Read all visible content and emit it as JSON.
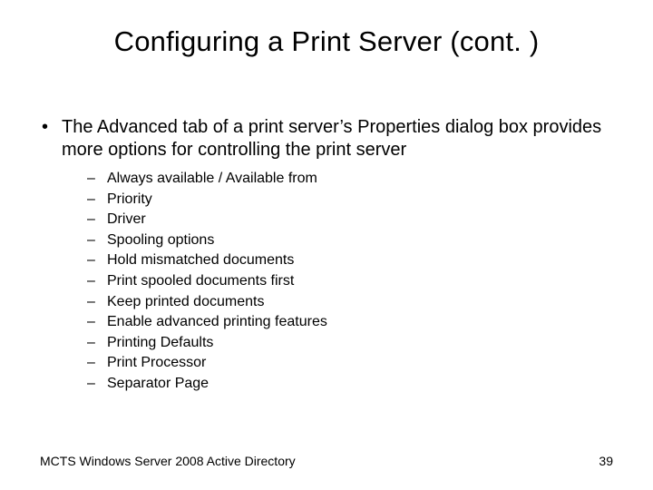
{
  "title": "Configuring a Print Server (cont. )",
  "bullet": {
    "text": "The Advanced tab of a print server’s Properties dialog box provides more options for controlling the print server",
    "sub": [
      "Always available / Available from",
      "Priority",
      "Driver",
      "Spooling options",
      "Hold mismatched documents",
      "Print spooled documents first",
      "Keep printed documents",
      "Enable advanced printing features",
      "Printing Defaults",
      "Print Processor",
      "Separator Page"
    ]
  },
  "footer": {
    "left": "MCTS Windows Server 2008 Active Directory",
    "page": "39"
  }
}
